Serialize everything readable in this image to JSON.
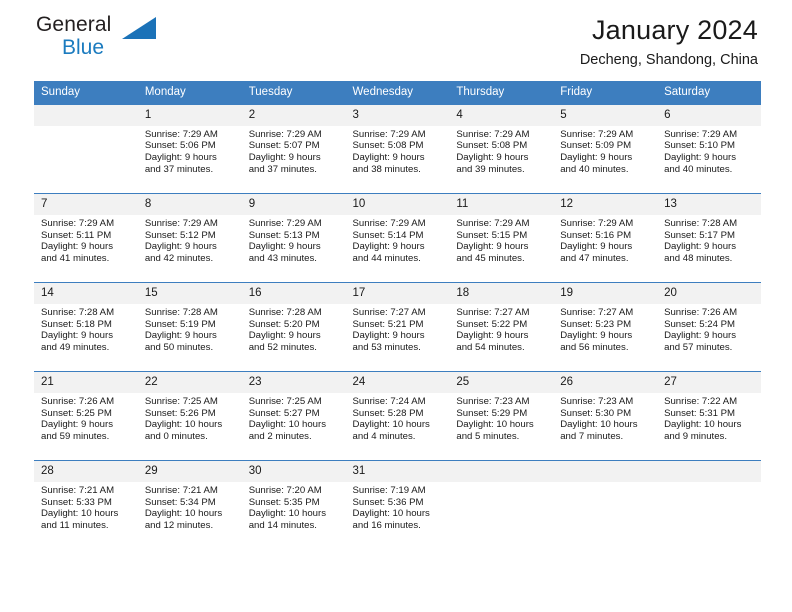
{
  "logo": {
    "line1": "General",
    "line2": "Blue",
    "triangle_icon": "triangle-icon",
    "brand_color": "#1b72b8"
  },
  "header": {
    "title": "January 2024",
    "subtitle": "Decheng, Shandong, China"
  },
  "calendar": {
    "header_bg": "#3d7ebf",
    "daynum_bg": "#f2f2f2",
    "weekday_headers": [
      "Sunday",
      "Monday",
      "Tuesday",
      "Wednesday",
      "Thursday",
      "Friday",
      "Saturday"
    ],
    "weeks": [
      [
        {
          "day": "",
          "sunrise": "",
          "sunset": "",
          "daylight1": "",
          "daylight2": ""
        },
        {
          "day": "1",
          "sunrise": "Sunrise: 7:29 AM",
          "sunset": "Sunset: 5:06 PM",
          "daylight1": "Daylight: 9 hours",
          "daylight2": "and 37 minutes."
        },
        {
          "day": "2",
          "sunrise": "Sunrise: 7:29 AM",
          "sunset": "Sunset: 5:07 PM",
          "daylight1": "Daylight: 9 hours",
          "daylight2": "and 37 minutes."
        },
        {
          "day": "3",
          "sunrise": "Sunrise: 7:29 AM",
          "sunset": "Sunset: 5:08 PM",
          "daylight1": "Daylight: 9 hours",
          "daylight2": "and 38 minutes."
        },
        {
          "day": "4",
          "sunrise": "Sunrise: 7:29 AM",
          "sunset": "Sunset: 5:08 PM",
          "daylight1": "Daylight: 9 hours",
          "daylight2": "and 39 minutes."
        },
        {
          "day": "5",
          "sunrise": "Sunrise: 7:29 AM",
          "sunset": "Sunset: 5:09 PM",
          "daylight1": "Daylight: 9 hours",
          "daylight2": "and 40 minutes."
        },
        {
          "day": "6",
          "sunrise": "Sunrise: 7:29 AM",
          "sunset": "Sunset: 5:10 PM",
          "daylight1": "Daylight: 9 hours",
          "daylight2": "and 40 minutes."
        }
      ],
      [
        {
          "day": "7",
          "sunrise": "Sunrise: 7:29 AM",
          "sunset": "Sunset: 5:11 PM",
          "daylight1": "Daylight: 9 hours",
          "daylight2": "and 41 minutes."
        },
        {
          "day": "8",
          "sunrise": "Sunrise: 7:29 AM",
          "sunset": "Sunset: 5:12 PM",
          "daylight1": "Daylight: 9 hours",
          "daylight2": "and 42 minutes."
        },
        {
          "day": "9",
          "sunrise": "Sunrise: 7:29 AM",
          "sunset": "Sunset: 5:13 PM",
          "daylight1": "Daylight: 9 hours",
          "daylight2": "and 43 minutes."
        },
        {
          "day": "10",
          "sunrise": "Sunrise: 7:29 AM",
          "sunset": "Sunset: 5:14 PM",
          "daylight1": "Daylight: 9 hours",
          "daylight2": "and 44 minutes."
        },
        {
          "day": "11",
          "sunrise": "Sunrise: 7:29 AM",
          "sunset": "Sunset: 5:15 PM",
          "daylight1": "Daylight: 9 hours",
          "daylight2": "and 45 minutes."
        },
        {
          "day": "12",
          "sunrise": "Sunrise: 7:29 AM",
          "sunset": "Sunset: 5:16 PM",
          "daylight1": "Daylight: 9 hours",
          "daylight2": "and 47 minutes."
        },
        {
          "day": "13",
          "sunrise": "Sunrise: 7:28 AM",
          "sunset": "Sunset: 5:17 PM",
          "daylight1": "Daylight: 9 hours",
          "daylight2": "and 48 minutes."
        }
      ],
      [
        {
          "day": "14",
          "sunrise": "Sunrise: 7:28 AM",
          "sunset": "Sunset: 5:18 PM",
          "daylight1": "Daylight: 9 hours",
          "daylight2": "and 49 minutes."
        },
        {
          "day": "15",
          "sunrise": "Sunrise: 7:28 AM",
          "sunset": "Sunset: 5:19 PM",
          "daylight1": "Daylight: 9 hours",
          "daylight2": "and 50 minutes."
        },
        {
          "day": "16",
          "sunrise": "Sunrise: 7:28 AM",
          "sunset": "Sunset: 5:20 PM",
          "daylight1": "Daylight: 9 hours",
          "daylight2": "and 52 minutes."
        },
        {
          "day": "17",
          "sunrise": "Sunrise: 7:27 AM",
          "sunset": "Sunset: 5:21 PM",
          "daylight1": "Daylight: 9 hours",
          "daylight2": "and 53 minutes."
        },
        {
          "day": "18",
          "sunrise": "Sunrise: 7:27 AM",
          "sunset": "Sunset: 5:22 PM",
          "daylight1": "Daylight: 9 hours",
          "daylight2": "and 54 minutes."
        },
        {
          "day": "19",
          "sunrise": "Sunrise: 7:27 AM",
          "sunset": "Sunset: 5:23 PM",
          "daylight1": "Daylight: 9 hours",
          "daylight2": "and 56 minutes."
        },
        {
          "day": "20",
          "sunrise": "Sunrise: 7:26 AM",
          "sunset": "Sunset: 5:24 PM",
          "daylight1": "Daylight: 9 hours",
          "daylight2": "and 57 minutes."
        }
      ],
      [
        {
          "day": "21",
          "sunrise": "Sunrise: 7:26 AM",
          "sunset": "Sunset: 5:25 PM",
          "daylight1": "Daylight: 9 hours",
          "daylight2": "and 59 minutes."
        },
        {
          "day": "22",
          "sunrise": "Sunrise: 7:25 AM",
          "sunset": "Sunset: 5:26 PM",
          "daylight1": "Daylight: 10 hours",
          "daylight2": "and 0 minutes."
        },
        {
          "day": "23",
          "sunrise": "Sunrise: 7:25 AM",
          "sunset": "Sunset: 5:27 PM",
          "daylight1": "Daylight: 10 hours",
          "daylight2": "and 2 minutes."
        },
        {
          "day": "24",
          "sunrise": "Sunrise: 7:24 AM",
          "sunset": "Sunset: 5:28 PM",
          "daylight1": "Daylight: 10 hours",
          "daylight2": "and 4 minutes."
        },
        {
          "day": "25",
          "sunrise": "Sunrise: 7:23 AM",
          "sunset": "Sunset: 5:29 PM",
          "daylight1": "Daylight: 10 hours",
          "daylight2": "and 5 minutes."
        },
        {
          "day": "26",
          "sunrise": "Sunrise: 7:23 AM",
          "sunset": "Sunset: 5:30 PM",
          "daylight1": "Daylight: 10 hours",
          "daylight2": "and 7 minutes."
        },
        {
          "day": "27",
          "sunrise": "Sunrise: 7:22 AM",
          "sunset": "Sunset: 5:31 PM",
          "daylight1": "Daylight: 10 hours",
          "daylight2": "and 9 minutes."
        }
      ],
      [
        {
          "day": "28",
          "sunrise": "Sunrise: 7:21 AM",
          "sunset": "Sunset: 5:33 PM",
          "daylight1": "Daylight: 10 hours",
          "daylight2": "and 11 minutes."
        },
        {
          "day": "29",
          "sunrise": "Sunrise: 7:21 AM",
          "sunset": "Sunset: 5:34 PM",
          "daylight1": "Daylight: 10 hours",
          "daylight2": "and 12 minutes."
        },
        {
          "day": "30",
          "sunrise": "Sunrise: 7:20 AM",
          "sunset": "Sunset: 5:35 PM",
          "daylight1": "Daylight: 10 hours",
          "daylight2": "and 14 minutes."
        },
        {
          "day": "31",
          "sunrise": "Sunrise: 7:19 AM",
          "sunset": "Sunset: 5:36 PM",
          "daylight1": "Daylight: 10 hours",
          "daylight2": "and 16 minutes."
        },
        {
          "day": "",
          "sunrise": "",
          "sunset": "",
          "daylight1": "",
          "daylight2": ""
        },
        {
          "day": "",
          "sunrise": "",
          "sunset": "",
          "daylight1": "",
          "daylight2": ""
        },
        {
          "day": "",
          "sunrise": "",
          "sunset": "",
          "daylight1": "",
          "daylight2": ""
        }
      ]
    ]
  }
}
